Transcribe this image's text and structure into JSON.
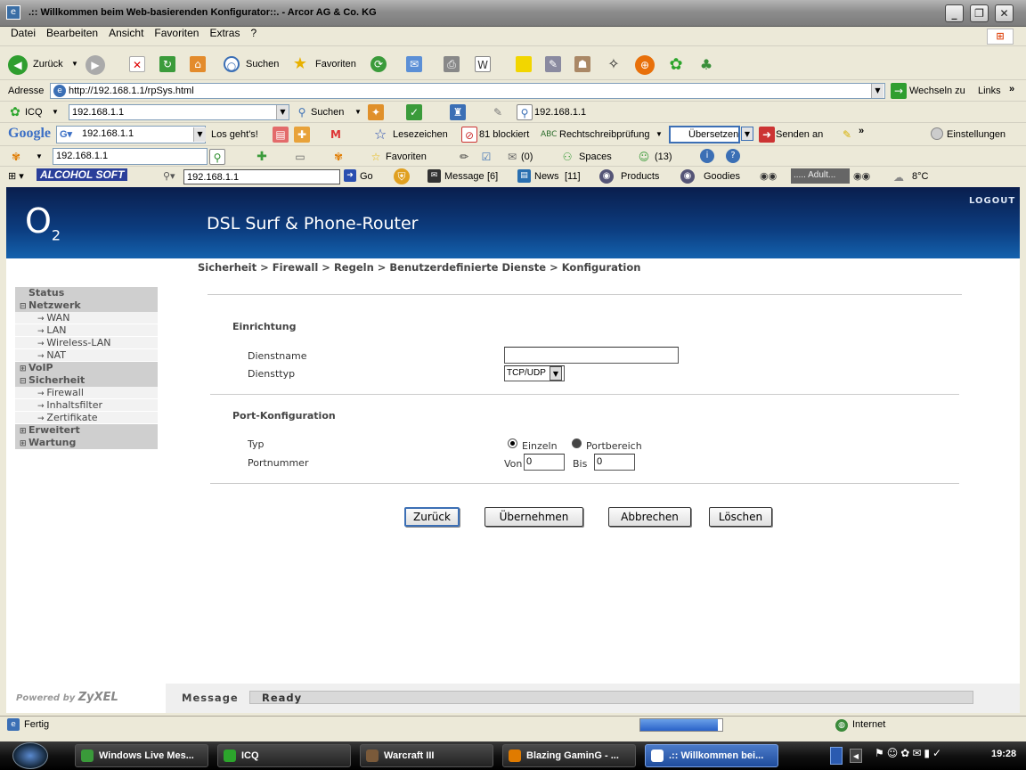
{
  "window": {
    "title": ".:: Willkommen beim Web-basierenden Konfigurator::. - Arcor AG & Co. KG",
    "minimize": "_",
    "maximize": "❐",
    "close": "✕"
  },
  "menu": [
    "Datei",
    "Bearbeiten",
    "Ansicht",
    "Favoriten",
    "Extras",
    "?"
  ],
  "toolbar": {
    "back": "Zurück",
    "search": "Suchen",
    "favorites": "Favoriten"
  },
  "address": {
    "label": "Adresse",
    "url": "http://192.168.1.1/rpSys.html",
    "go": "Wechseln zu",
    "links": "Links"
  },
  "icqbar": {
    "label": "ICQ",
    "field": "192.168.1.1",
    "search": "Suchen",
    "page": "192.168.1.1"
  },
  "googlebar": {
    "logo": "Google",
    "field": "192.168.1.1",
    "go": "Los geht's!",
    "bookmarks": "Lesezeichen",
    "blocked": "81 blockiert",
    "spell": "Rechtschreibprüfung",
    "translate": "Übersetzen",
    "send": "Senden an",
    "settings": "Einstellungen"
  },
  "msnbar": {
    "field": "192.168.1.1",
    "favorites": "Favoriten",
    "mail": "(0)",
    "spaces": "Spaces",
    "buddies": "(13)"
  },
  "alcoholbar": {
    "logo": "ALCOHOL SOFT",
    "field": "192.168.1.1",
    "go": "Go",
    "message": "Message",
    "message_count": "[6]",
    "news": "News",
    "news_count": "[11]",
    "products": "Products",
    "goodies": "Goodies",
    "adult": "..... Adult...",
    "temp": "8°C"
  },
  "router": {
    "logo": "O",
    "logo_sub": "2",
    "title": "DSL Surf & Phone-Router",
    "logout": "LOGOUT",
    "breadcrumb": "Sicherheit > Firewall > Regeln > Benutzerdefinierte Dienste > Konfiguration",
    "sidebar": [
      {
        "label": "Status",
        "kind": "top",
        "sign": ""
      },
      {
        "label": "Netzwerk",
        "kind": "sec",
        "sign": "−"
      },
      {
        "label": "WAN",
        "kind": "sub"
      },
      {
        "label": "LAN",
        "kind": "sub"
      },
      {
        "label": "Wireless-LAN",
        "kind": "sub"
      },
      {
        "label": "NAT",
        "kind": "sub"
      },
      {
        "label": "VoIP",
        "kind": "sec",
        "sign": "+"
      },
      {
        "label": "Sicherheit",
        "kind": "sec",
        "sign": "−"
      },
      {
        "label": "Firewall",
        "kind": "sub"
      },
      {
        "label": "Inhaltsfilter",
        "kind": "sub"
      },
      {
        "label": "Zertifikate",
        "kind": "sub"
      },
      {
        "label": "Erweitert",
        "kind": "sec",
        "sign": "+"
      },
      {
        "label": "Wartung",
        "kind": "sec",
        "sign": "+"
      }
    ],
    "form": {
      "section1": "Einrichtung",
      "service_name_label": "Dienstname",
      "service_name_value": "",
      "service_type_label": "Diensttyp",
      "service_type_value": "TCP/UDP",
      "section2": "Port-Konfiguration",
      "type_label": "Typ",
      "radio_single": "Einzeln",
      "radio_range": "Portbereich",
      "port_label": "Portnummer",
      "from_label": "Von",
      "from_value": "0",
      "to_label": "Bis",
      "to_value": "0"
    },
    "buttons": {
      "back": "Zurück",
      "apply": "Übernehmen",
      "cancel": "Abbrechen",
      "delete": "Löschen"
    },
    "footer": {
      "powered": "Powered by",
      "brand": "ZyXEL",
      "message_label": "Message",
      "message_value": "Ready"
    }
  },
  "statusbar": {
    "text": "Fertig",
    "zone": "Internet",
    "progress": 0.95
  },
  "taskbar": {
    "tasks": [
      "Windows Live Mes...",
      "ICQ",
      "Warcraft III",
      "Blazing GaminG - ...",
      ".:: Willkommen bei..."
    ],
    "clock": "19:28"
  },
  "colors": {
    "o2_dark": "#0a1e4d",
    "o2_light": "#1462ae",
    "accent": "#3c6fb5"
  }
}
